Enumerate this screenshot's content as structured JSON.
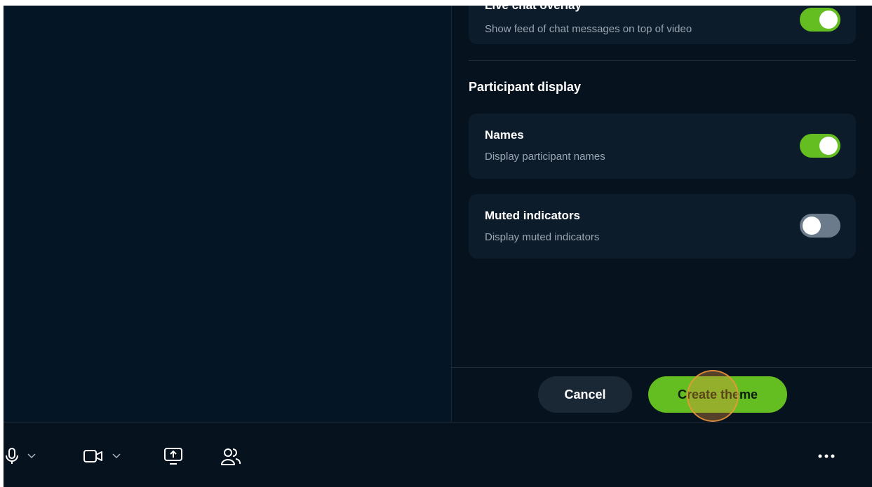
{
  "overlay_setting": {
    "title": "Live chat overlay",
    "description": "Show feed of chat messages on top of video",
    "enabled": true
  },
  "participant_display": {
    "section_title": "Participant display",
    "names": {
      "title": "Names",
      "description": "Display participant names",
      "enabled": true
    },
    "muted_indicators": {
      "title": "Muted indicators",
      "description": "Display muted indicators",
      "enabled": false
    }
  },
  "footer": {
    "cancel_label": "Cancel",
    "create_label": "Create theme"
  },
  "toolbar": {
    "icons": [
      "microphone-icon",
      "chevron-down-icon",
      "camera-icon",
      "chevron-down-icon",
      "share-screen-icon",
      "participants-icon",
      "more-icon"
    ]
  },
  "colors": {
    "accent_green": "#64be22",
    "toggle_off": "#6c7b8c",
    "background": "#06131f",
    "card": "#0d1c2a"
  }
}
